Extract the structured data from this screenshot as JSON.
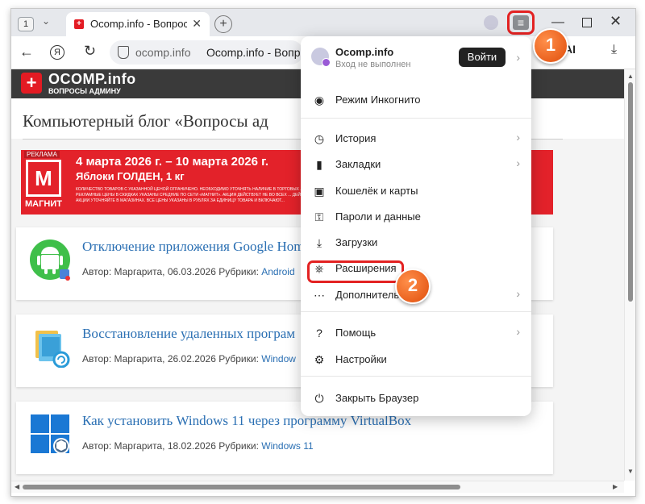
{
  "browser": {
    "tab_count": "1",
    "tab_title": "Ocomp.info - Вопросы а",
    "address_domain": "ocomp.info",
    "address_title": "Ocomp.info - Вопрос",
    "ai_label": "AI"
  },
  "site": {
    "logo_name": "OCOMP.info",
    "logo_sub": "ВОПРОСЫ АДМИНУ",
    "page_title": "Компьютерный блог «Вопросы ад"
  },
  "ad": {
    "tag": "РЕКЛАМА",
    "logo_letter": "М",
    "brand": "МАГНИТ",
    "line1": "4 марта 2026 г. – 10 марта 2026 г.",
    "line2": "Яблоки ГОЛДЕН, 1 кг",
    "fine_print": "КОЛИЧЕСТВО ТОВАРОВ С УКАЗАННОЙ ЦЕНОЙ ОГРАНИЧЕНО. НЕОБХОДИМО УТОЧНЯТЬ НАЛИЧИЕ В ТОРГОВЫХ ... РЕКЛАМНЫЕ ЦЕНЫ В СКИДКАХ УКАЗАНЫ СРЕДНИЕ ПО СЕТИ «МАГНИТ». АКЦИЯ ДЕЙСТВУЕТ НЕ ВО ВСЕХ ... ДЕЙСТВИЯ АКЦИИ УТОЧНЯЙТЕ В МАГАЗИНАХ. ВСЕ ЦЕНЫ УКАЗАНЫ В РУБЛЯХ ЗА ЕДИНИЦУ ТОВАРА И ВКЛЮЧАЮТ..."
  },
  "articles": [
    {
      "title": "Отключение приложения Google Hom",
      "author": "Автор: Маргарита, 06.03.2026 Рубрики: ",
      "category": "Android"
    },
    {
      "title": "Восстановление удаленных програм",
      "author": "Автор: Маргарита, 26.02.2026 Рубрики: ",
      "category": "Window"
    },
    {
      "title": "Как установить Windows 11 через программу VirtualBox",
      "author": "Автор: Маргарита, 18.02.2026 Рубрики: ",
      "category": "Windows 11"
    }
  ],
  "menu": {
    "site": "Ocomp.info",
    "status": "Вход не выполнен",
    "login": "Войти",
    "items": [
      {
        "label": "Режим Инкогнито",
        "icon": "incognito-icon"
      },
      {
        "label": "История",
        "icon": "history-icon"
      },
      {
        "label": "Закладки",
        "icon": "bookmarks-icon"
      },
      {
        "label": "Кошелёк и карты",
        "icon": "wallet-icon"
      },
      {
        "label": "Пароли и данные",
        "icon": "passwords-icon"
      },
      {
        "label": "Загрузки",
        "icon": "download-icon"
      },
      {
        "label": "Расширения",
        "icon": "extensions-icon"
      },
      {
        "label": "Дополнительно",
        "icon": "more-icon"
      },
      {
        "label": "Помощь",
        "icon": "help-icon"
      },
      {
        "label": "Настройки",
        "icon": "settings-icon"
      },
      {
        "label": "Закрыть Браузер",
        "icon": "power-icon"
      }
    ]
  },
  "annotations": {
    "badge1": "1",
    "badge2": "2",
    "color": "#e32222"
  }
}
